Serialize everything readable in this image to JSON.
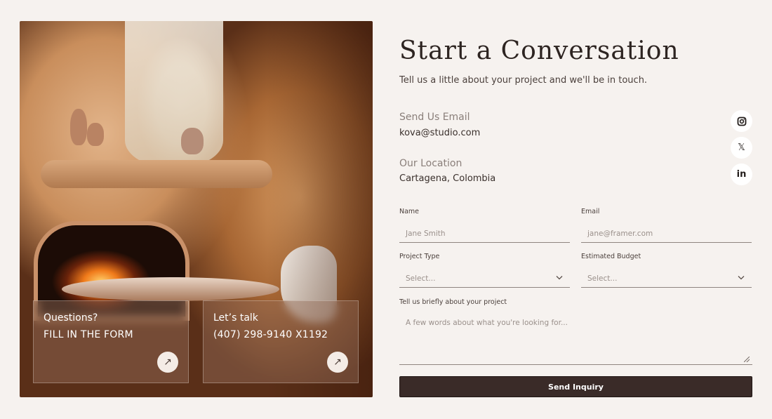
{
  "heading": {
    "title": "Start a Conversation",
    "subtitle": "Tell us a little about your project and we'll be in touch."
  },
  "contact": {
    "email_label": "Send Us Email",
    "email_value": "kova@studio.com",
    "location_label": "Our Location",
    "location_value": "Cartagena, Colombia"
  },
  "social": [
    {
      "icon": "instagram-icon"
    },
    {
      "icon": "x-icon",
      "glyph": "𝕏"
    },
    {
      "icon": "linkedin-icon",
      "glyph": "in"
    }
  ],
  "cards": [
    {
      "line1": "Questions?",
      "line2": "FILL IN THE FORM",
      "icon": "arrow-up-right-icon",
      "glyph": "↗"
    },
    {
      "line1": "Let’s talk",
      "line2": "(407) 298-9140 X1192",
      "icon": "arrow-up-right-icon",
      "glyph": "↗"
    }
  ],
  "form": {
    "name_label": "Name",
    "name_placeholder": "Jane Smith",
    "email_label": "Email",
    "email_placeholder": "jane@framer.com",
    "project_type_label": "Project Type",
    "project_type_value": "Select...",
    "budget_label": "Estimated Budget",
    "budget_value": "Select...",
    "chevron_glyph": "⌄",
    "message_label": "Tell us briefly about your project",
    "message_placeholder": "A few words about what you're looking for...",
    "submit_label": "Send Inquiry"
  }
}
